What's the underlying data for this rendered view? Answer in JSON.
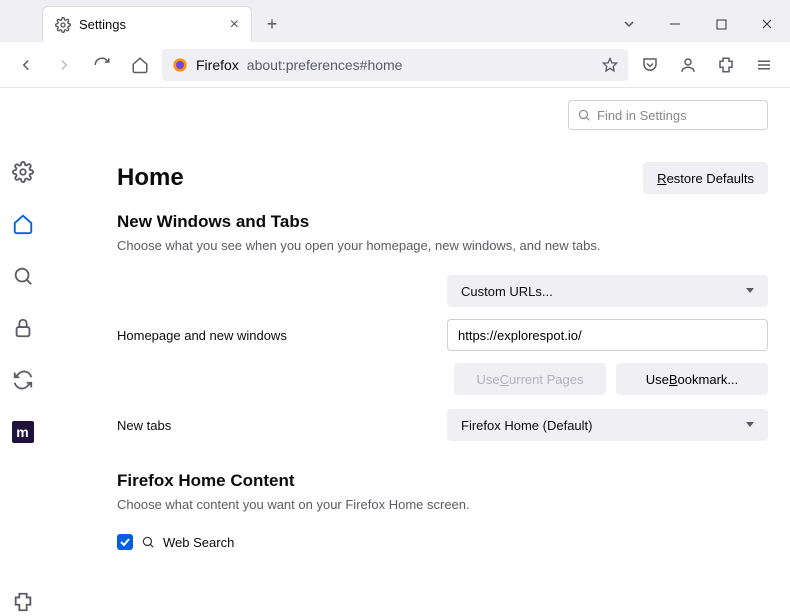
{
  "tab": {
    "title": "Settings"
  },
  "urlbar": {
    "label": "Firefox",
    "url": "about:preferences#home"
  },
  "search": {
    "placeholder": "Find in Settings"
  },
  "page": {
    "title": "Home",
    "restore": "Restore Defaults",
    "section1_title": "New Windows and Tabs",
    "section1_desc": "Choose what you see when you open your homepage, new windows, and new tabs.",
    "homepage_label": "Homepage and new windows",
    "homepage_select": "Custom URLs...",
    "homepage_url": "https://explorespot.io/",
    "use_current": "Use Current Pages",
    "use_bookmark": "Use Bookmark...",
    "newtabs_label": "New tabs",
    "newtabs_select": "Firefox Home (Default)",
    "section2_title": "Firefox Home Content",
    "section2_desc": "Choose what content you want on your Firefox Home screen.",
    "web_search": "Web Search"
  }
}
